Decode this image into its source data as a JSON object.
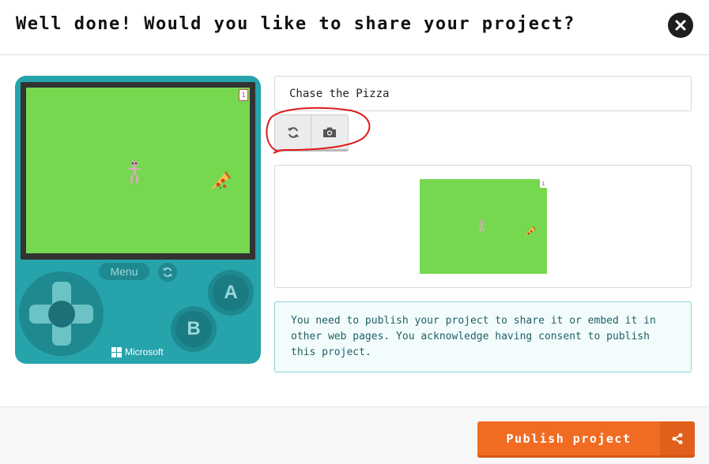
{
  "dialog": {
    "title": "Well done! Would you like to share your project?"
  },
  "simulator": {
    "score": "1",
    "menu_label": "Menu",
    "button_a": "A",
    "button_b": "B",
    "brand": "Microsoft",
    "screen_color": "#75d84f",
    "body_color": "#26a3ab"
  },
  "project": {
    "name": "Chase the Pizza"
  },
  "thumbnail": {
    "refresh_icon": "refresh-icon",
    "screenshot_icon": "camera-icon",
    "score": "1"
  },
  "info": {
    "text": "You need to publish your project to share it or embed it in other web pages. You acknowledge having consent to publish this project."
  },
  "footer": {
    "publish_label": "Publish project",
    "share_icon": "share-icon",
    "accent": "#f26b22"
  }
}
